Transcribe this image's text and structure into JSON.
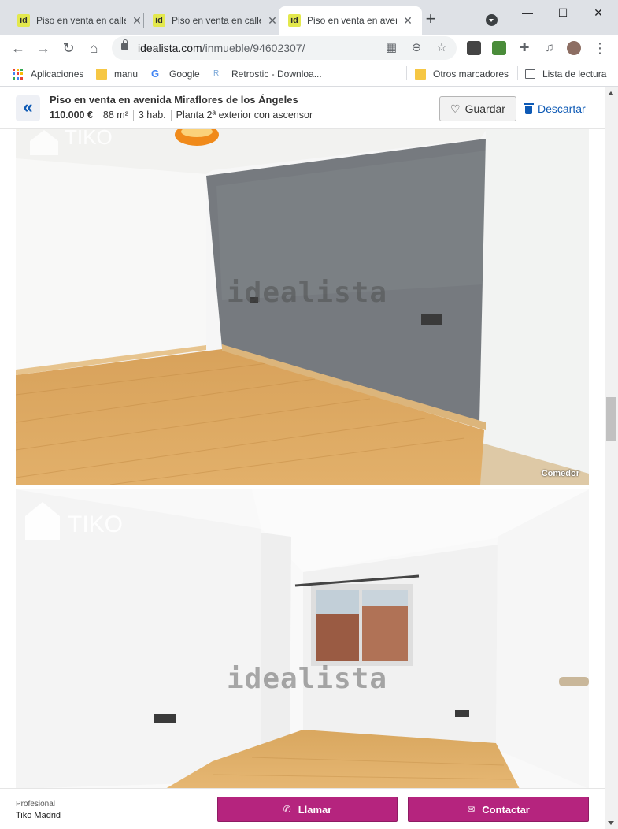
{
  "browser": {
    "tabs": [
      {
        "favicon": "id",
        "title": "Piso en venta en calle"
      },
      {
        "favicon": "id",
        "title": "Piso en venta en calle"
      },
      {
        "favicon": "id",
        "title": "Piso en venta en avenida",
        "active": true
      }
    ],
    "url_host": "idealista.com",
    "url_path": "/inmueble/94602307/",
    "bookmarks": [
      {
        "label": "Aplicaciones",
        "icon": "apps-grid-icon"
      },
      {
        "label": "manu",
        "icon": "folder-icon"
      },
      {
        "label": "Google",
        "icon": "google-icon"
      },
      {
        "label": "Retrostic - Downloa...",
        "icon": "retrostic-icon"
      }
    ],
    "other_bookmarks": "Otros marcadores",
    "reading_list": "Lista de lectura"
  },
  "listing": {
    "title": "Piso en venta en avenida Miraflores de los Ángeles",
    "price": "110.000 €",
    "area": "88 m²",
    "rooms": "3 hab.",
    "floor": "Planta 2ª exterior con ascensor",
    "save_label": "Guardar",
    "discard_label": "Descartar"
  },
  "photos": [
    {
      "caption": "Comedor",
      "watermark": "idealista",
      "brand": "TIKO"
    },
    {
      "caption": "",
      "watermark": "idealista",
      "brand": "TIKO"
    }
  ],
  "contact": {
    "type_label": "Profesional",
    "agency": "Tiko Madrid",
    "call_label": "Llamar",
    "contact_label": "Contactar"
  },
  "colors": {
    "accent": "#b5247e",
    "link": "#0e5ab5",
    "favicon_bg": "#e3e84d"
  }
}
